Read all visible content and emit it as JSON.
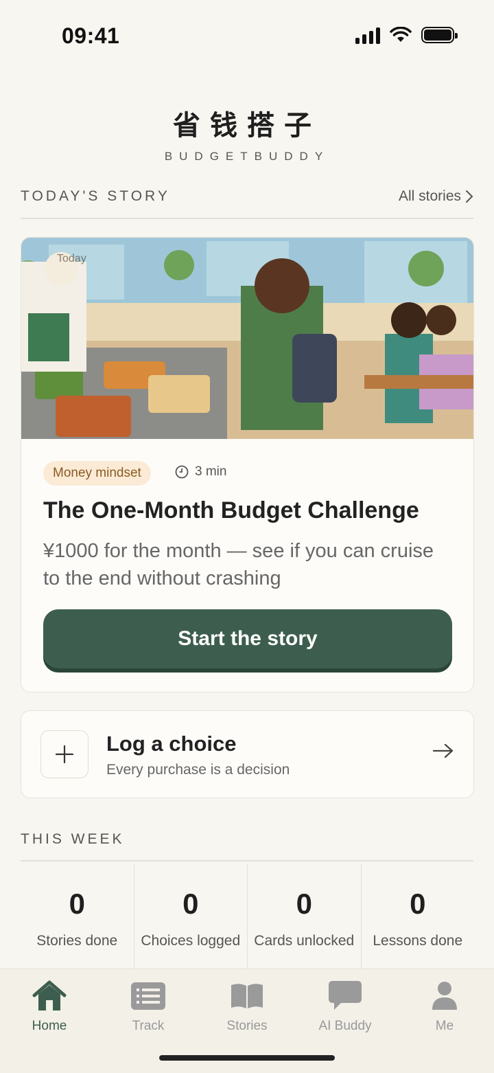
{
  "status_bar": {
    "time": "09:41"
  },
  "header": {
    "title": "省钱搭子",
    "subtitle": "BUDGETBUDDY"
  },
  "todays_story": {
    "section_label": "TODAY'S STORY",
    "all_link": "All stories",
    "image_overlay": "Today",
    "tag": "Money mindset",
    "duration": "3 min",
    "title": "The One-Month Budget Challenge",
    "description": "¥1000 for the month — see if you can cruise to the end without crashing",
    "cta": "Start the story"
  },
  "log_choice": {
    "title": "Log a choice",
    "subtitle": "Every purchase is a decision"
  },
  "this_week": {
    "section_label": "THIS WEEK",
    "stats": [
      {
        "value": "0",
        "label": "Stories done"
      },
      {
        "value": "0",
        "label": "Choices logged"
      },
      {
        "value": "0",
        "label": "Cards unlocked"
      },
      {
        "value": "0",
        "label": "Lessons done"
      }
    ]
  },
  "tabs": [
    {
      "label": "Home",
      "icon": "home-icon",
      "active": true
    },
    {
      "label": "Track",
      "icon": "list-icon",
      "active": false
    },
    {
      "label": "Stories",
      "icon": "book-icon",
      "active": false
    },
    {
      "label": "AI Buddy",
      "icon": "chat-icon",
      "active": false
    },
    {
      "label": "Me",
      "icon": "person-icon",
      "active": false
    }
  ],
  "colors": {
    "accent": "#3d5e4e",
    "background": "#f8f6f0",
    "tag_bg": "#fbebd6",
    "tag_text": "#8a5a22"
  }
}
